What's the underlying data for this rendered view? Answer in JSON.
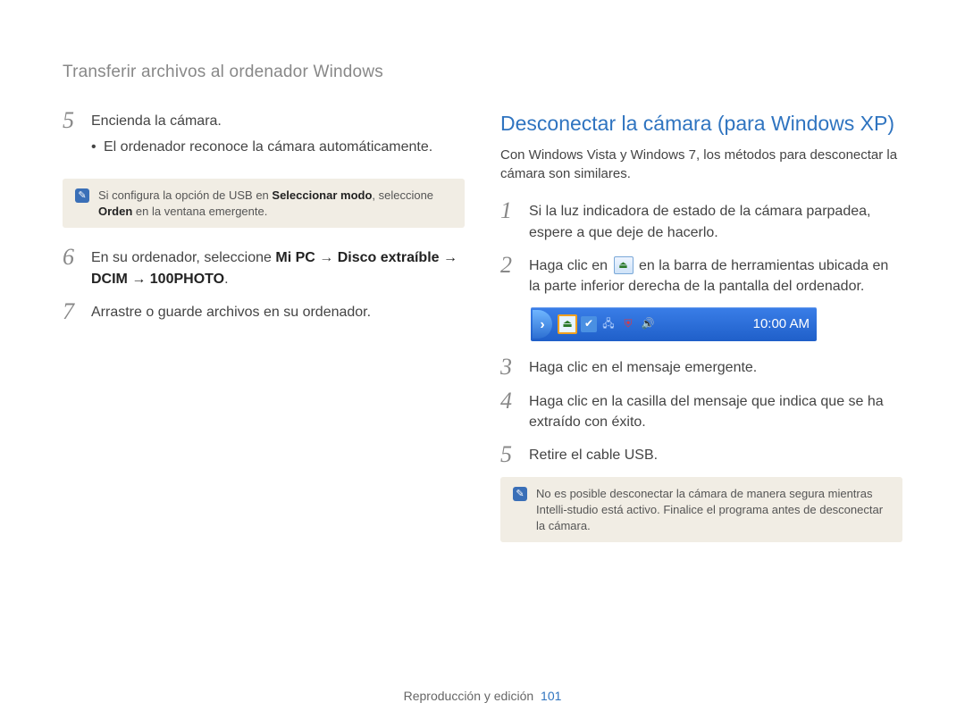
{
  "breadcrumb": "Transferir archivos al ordenador Windows",
  "left": {
    "step5": {
      "num": "5",
      "text": "Encienda la cámara.",
      "bullet": "El ordenador reconoce la cámara automáticamente."
    },
    "note1_pre": "Si configura la opción de USB en ",
    "note1_b1": "Seleccionar modo",
    "note1_mid": ", seleccione ",
    "note1_b2": "Orden",
    "note1_post": " en la ventana emergente.",
    "step6": {
      "num": "6",
      "pre": "En su ordenador, seleccione ",
      "b1": "Mi PC",
      "arrow": " → ",
      "b2": "Disco extraíble",
      "b3": "DCIM",
      "b4": "100PHOTO",
      "post": "."
    },
    "step7": {
      "num": "7",
      "text": "Arrastre o guarde archivos en su ordenador."
    }
  },
  "right": {
    "title": "Desconectar la cámara (para Windows XP)",
    "intro": "Con Windows Vista y Windows 7, los métodos para desconectar la cámara son similares.",
    "s1": {
      "num": "1",
      "text": "Si la luz indicadora de estado de la cámara parpadea, espere a que deje de hacerlo."
    },
    "s2": {
      "num": "2",
      "pre": "Haga clic en ",
      "post": " en la barra de herramientas ubicada en la parte inferior derecha de la pantalla del ordenador."
    },
    "taskbar_time": "10:00 AM",
    "s3": {
      "num": "3",
      "text": "Haga clic en el mensaje emergente."
    },
    "s4": {
      "num": "4",
      "text": "Haga clic en la casilla del mensaje que indica que se ha extraído con éxito."
    },
    "s5": {
      "num": "5",
      "text": "Retire el cable USB."
    },
    "note2": "No es posible desconectar la cámara de manera segura mientras Intelli-studio está activo. Finalice el programa antes de desconectar la cámara."
  },
  "footer": {
    "section": "Reproducción y edición",
    "page": "101"
  }
}
